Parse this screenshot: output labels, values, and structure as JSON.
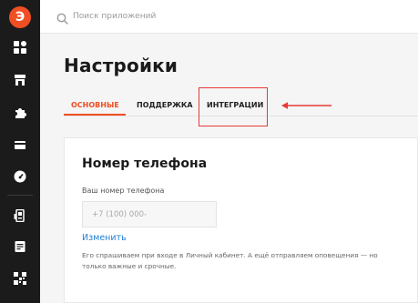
{
  "brand": {
    "logo_letter": "Э",
    "accent_color": "#f04e23"
  },
  "sidebar": {
    "items": [
      {
        "icon": "dashboard-icon"
      },
      {
        "icon": "store-icon"
      },
      {
        "icon": "puzzle-icon"
      },
      {
        "icon": "card-icon"
      },
      {
        "icon": "speedometer-icon"
      },
      {
        "icon": "device-icon"
      },
      {
        "icon": "receipt-icon"
      },
      {
        "icon": "qr-code-icon"
      }
    ]
  },
  "search": {
    "placeholder": "Поиск приложений",
    "value": ""
  },
  "page": {
    "title": "Настройки"
  },
  "tabs": [
    {
      "label": "Основные",
      "active": true
    },
    {
      "label": "Поддержка",
      "active": false
    },
    {
      "label": "Интеграции",
      "active": false
    }
  ],
  "annotation": {
    "highlight_color": "#e53935"
  },
  "phone_card": {
    "title": "Номер телефона",
    "field_label": "Ваш номер телефона",
    "placeholder": "+7 (100) 000-",
    "value": "",
    "change_link": "Изменить",
    "hint": "Его спрашиваем при входе в Личный кабинет. А ещё отправляем оповещения — но только важные и срочные."
  }
}
